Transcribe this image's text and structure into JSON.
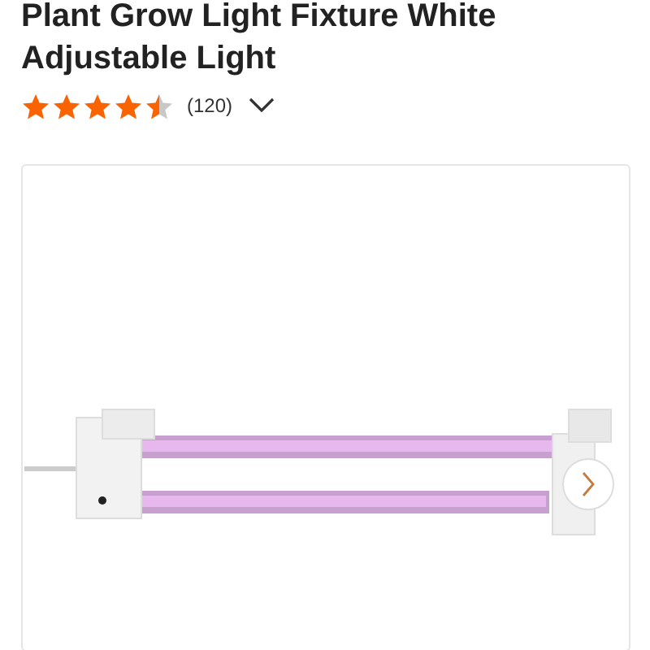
{
  "product": {
    "title": "Plant Grow Light Fixture White Adjustable Light",
    "rating": {
      "stars": 4.5,
      "count": "(120)"
    }
  }
}
